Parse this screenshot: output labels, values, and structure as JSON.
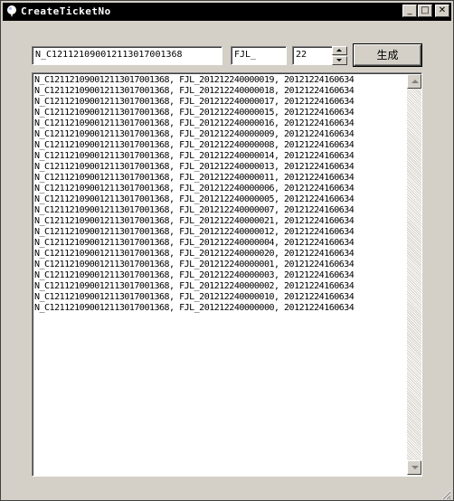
{
  "window": {
    "title": "CreateTicketNo",
    "controls": {
      "minimize": "_",
      "maximize": "□",
      "close": "✕"
    },
    "app_icon": "balloon-icon"
  },
  "form": {
    "ticket_prefix_value": "N_C121121090012113017001368",
    "code_prefix_value": "FJL_",
    "count_value": "22",
    "generate_label": "生成"
  },
  "output": {
    "lines": [
      "N_C121121090012113017001368, FJL_201212240000019, 20121224160634",
      "N_C121121090012113017001368, FJL_201212240000018, 20121224160634",
      "N_C121121090012113017001368, FJL_201212240000017, 20121224160634",
      "N_C121121090012113017001368, FJL_201212240000015, 20121224160634",
      "N_C121121090012113017001368, FJL_201212240000016, 20121224160634",
      "N_C121121090012113017001368, FJL_201212240000009, 20121224160634",
      "N_C121121090012113017001368, FJL_201212240000008, 20121224160634",
      "N_C121121090012113017001368, FJL_201212240000014, 20121224160634",
      "N_C121121090012113017001368, FJL_201212240000013, 20121224160634",
      "N_C121121090012113017001368, FJL_201212240000011, 20121224160634",
      "N_C121121090012113017001368, FJL_201212240000006, 20121224160634",
      "N_C121121090012113017001368, FJL_201212240000005, 20121224160634",
      "N_C121121090012113017001368, FJL_201212240000007, 20121224160634",
      "N_C121121090012113017001368, FJL_201212240000021, 20121224160634",
      "N_C121121090012113017001368, FJL_201212240000012, 20121224160634",
      "N_C121121090012113017001368, FJL_201212240000004, 20121224160634",
      "N_C121121090012113017001368, FJL_201212240000020, 20121224160634",
      "N_C121121090012113017001368, FJL_201212240000001, 20121224160634",
      "N_C121121090012113017001368, FJL_201212240000003, 20121224160634",
      "N_C121121090012113017001368, FJL_201212240000002, 20121224160634",
      "N_C121121090012113017001368, FJL_201212240000010, 20121224160634",
      "N_C121121090012113017001368, FJL_201212240000000, 20121224160634"
    ]
  },
  "colors": {
    "face": "#d4d0c8",
    "titlebar": "#000000",
    "title_text": "#ffffff",
    "field_bg": "#ffffff"
  }
}
